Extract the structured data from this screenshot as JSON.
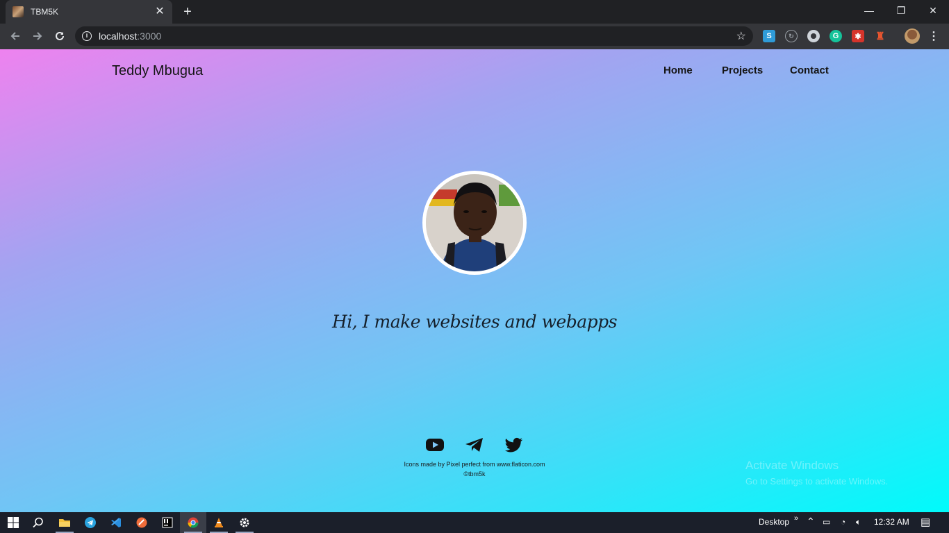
{
  "browser": {
    "tab_title": "TBM5K",
    "tab_close": "✕",
    "new_tab": "+",
    "url_host": "localhost",
    "url_port": ":3000",
    "window_controls": {
      "minimize": "—",
      "maximize": "❐",
      "close": "✕"
    },
    "extensions": [
      "skype-icon",
      "sync-icon",
      "circle-icon",
      "grammarly-icon",
      "pixel-icon",
      "rocket-icon"
    ]
  },
  "site": {
    "brand": "Teddy Mbugua",
    "nav": [
      "Home",
      "Projects",
      "Contact"
    ],
    "tagline": "Hi, I make websites and webapps",
    "social_icons": [
      "youtube-icon",
      "telegram-icon",
      "twitter-icon"
    ],
    "credit": "Icons made by Pixel perfect from www.flaticon.com",
    "copyright": "©tbm5k",
    "colors": {
      "gradient_start": "#ee82ef",
      "gradient_end": "#00fbfb"
    }
  },
  "os": {
    "watermark_title": "Activate Windows",
    "watermark_sub": "Go to Settings to activate Windows.",
    "taskbar_label": "Desktop",
    "clock": "12:32 AM",
    "taskbar_apps": [
      "start-icon",
      "search-icon",
      "file-explorer-icon",
      "telegram-icon",
      "vscode-icon",
      "postman-icon",
      "intellij-icon",
      "chrome-icon",
      "vlc-icon",
      "settings-icon"
    ]
  }
}
